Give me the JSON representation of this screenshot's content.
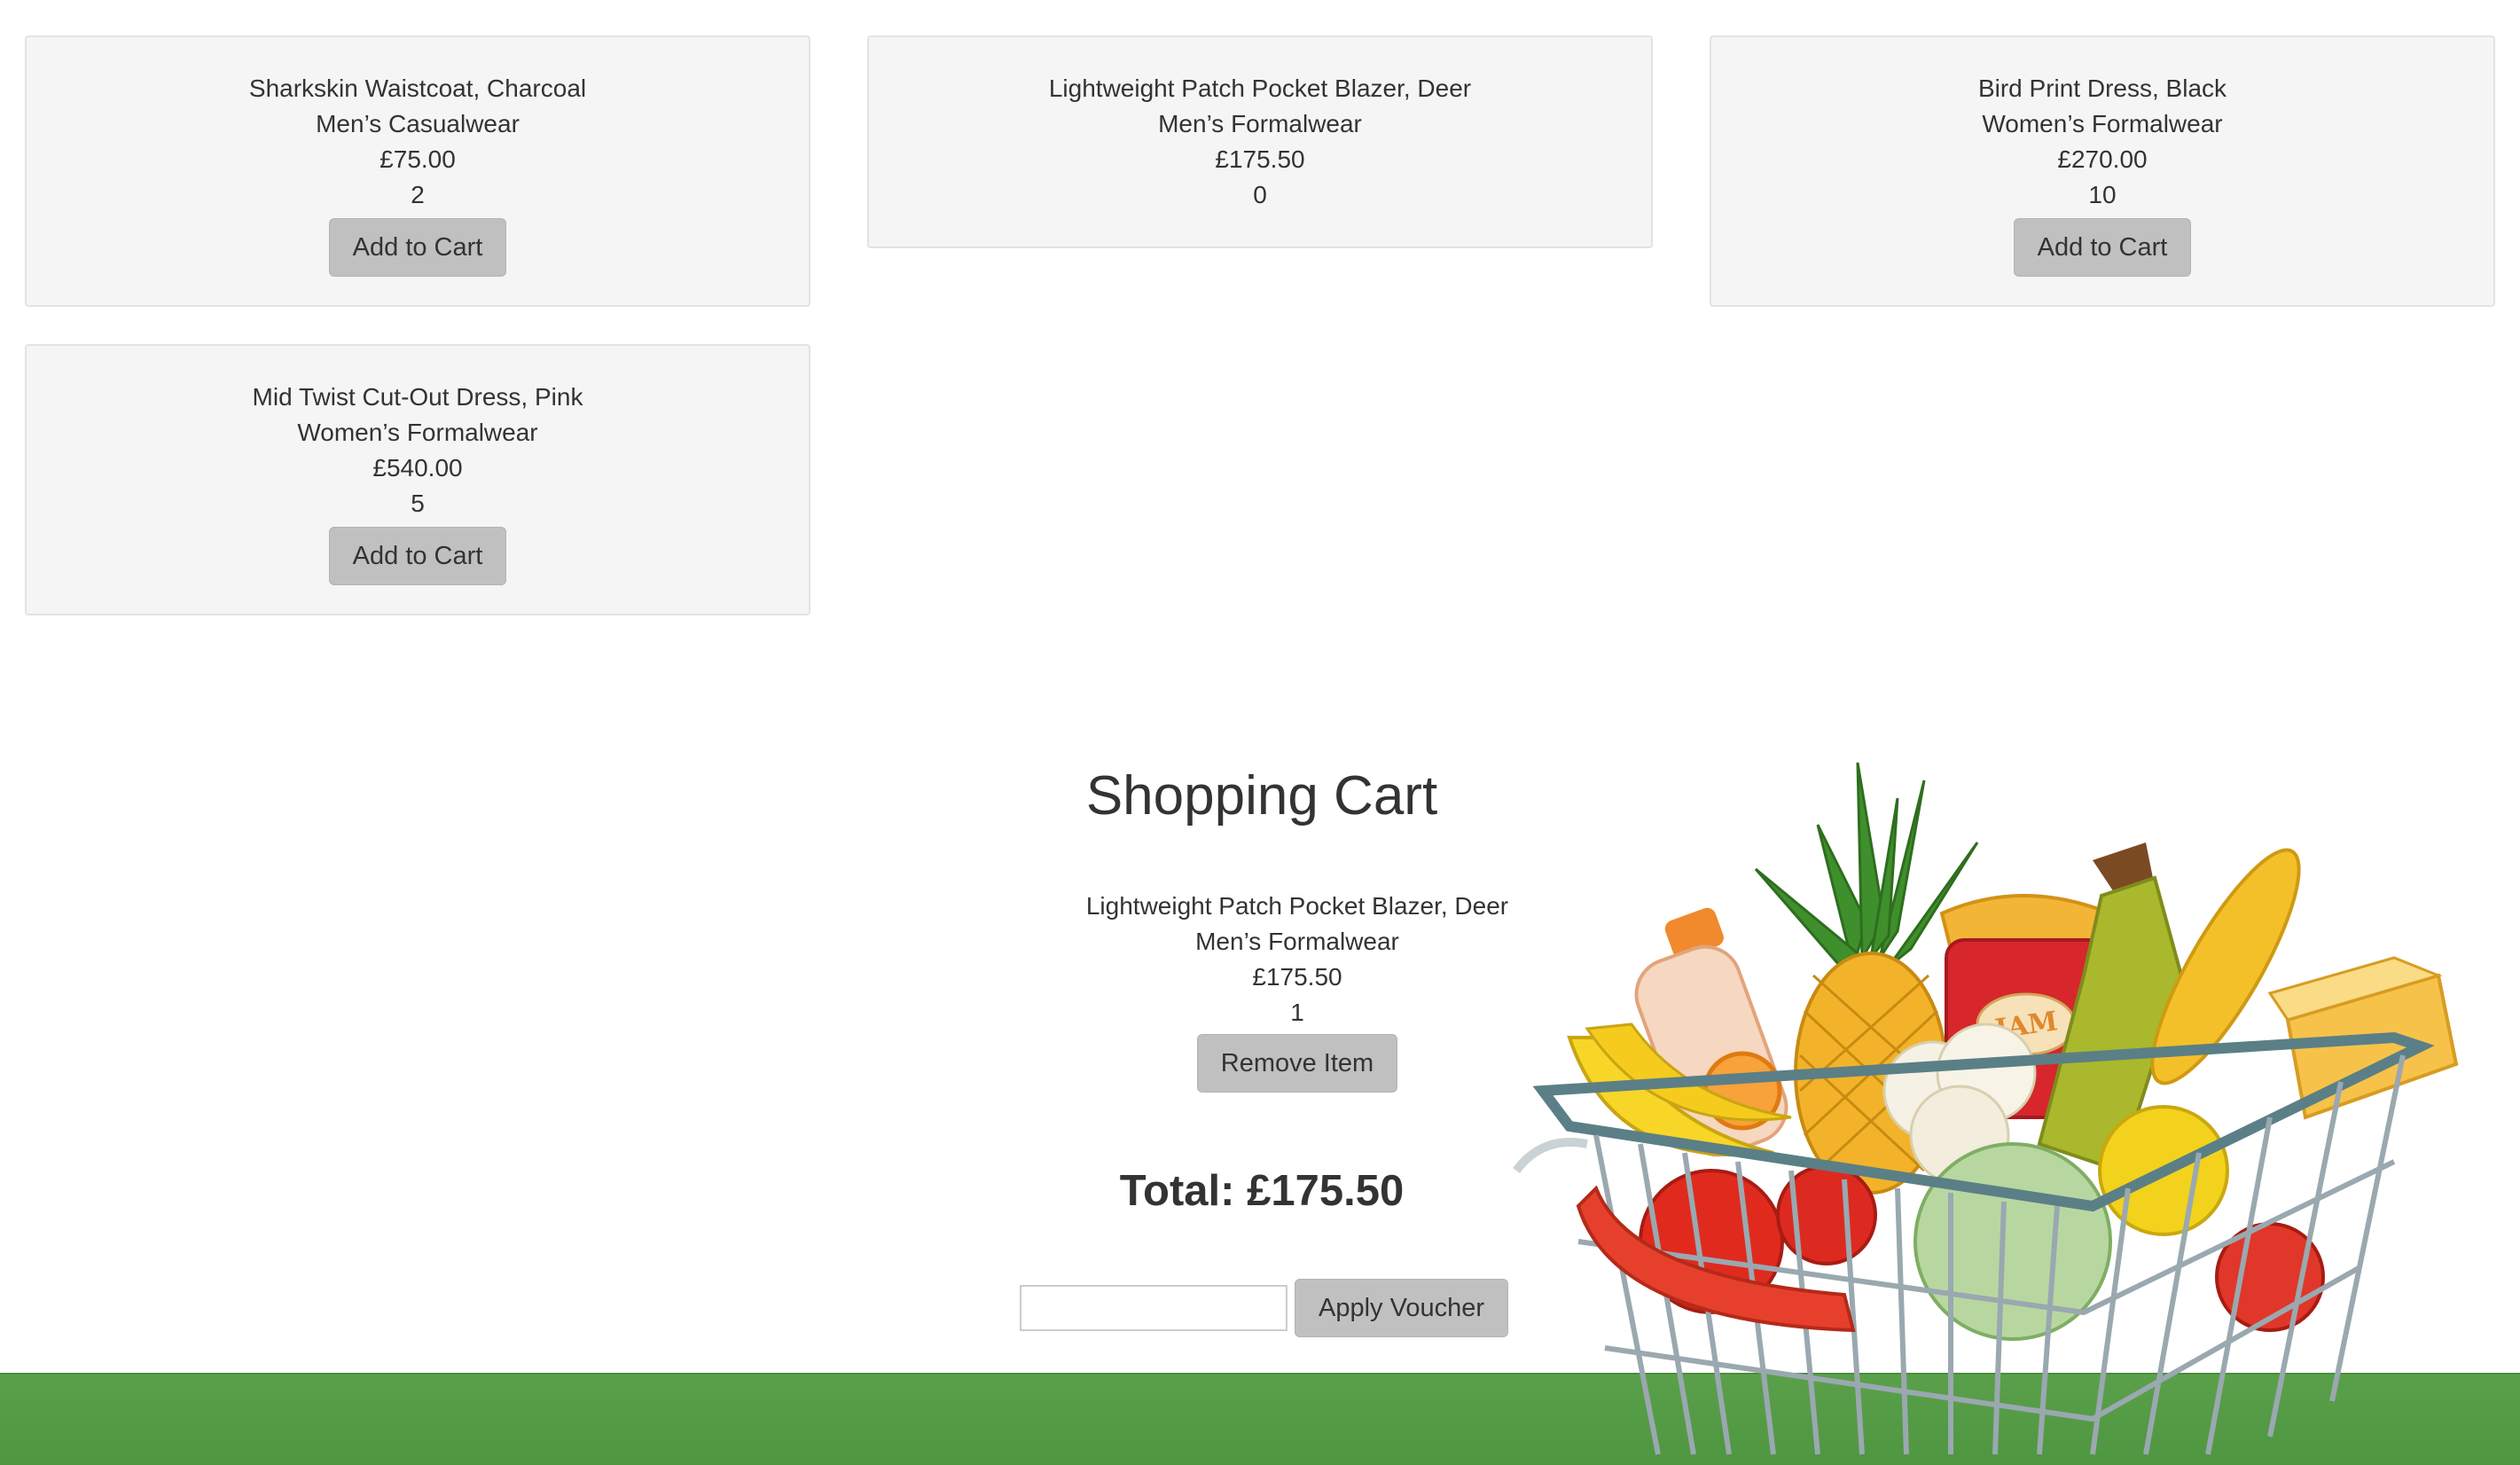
{
  "products": [
    {
      "name": "Sharkskin Waistcoat, Charcoal",
      "category": "Men’s Casualwear",
      "price": "£75.00",
      "stock": "2",
      "button": "Add to Cart"
    },
    {
      "name": "Lightweight Patch Pocket Blazer, Deer",
      "category": "Men’s Formalwear",
      "price": "£175.50",
      "stock": "0"
    },
    {
      "name": "Bird Print Dress, Black",
      "category": "Women’s Formalwear",
      "price": "£270.00",
      "stock": "10",
      "button": "Add to Cart"
    },
    {
      "name": "Mid Twist Cut-Out Dress, Pink",
      "category": "Women’s Formalwear",
      "price": "£540.00",
      "stock": "5",
      "button": "Add to Cart"
    }
  ],
  "cart": {
    "title": "Shopping Cart",
    "items": [
      {
        "name": "Lightweight Patch Pocket Blazer, Deer",
        "category": "Men’s Formalwear",
        "price": "£175.50",
        "quantity": "1",
        "button": "Remove Item"
      }
    ],
    "total": "Total: £175.50",
    "voucher": {
      "value": "",
      "placeholder": "",
      "button": "Apply Voucher"
    }
  },
  "colors": {
    "card_bg": "#f5f5f5",
    "button_bg": "#c0c0c0",
    "footer_green": "#569d46",
    "text": "#333333"
  },
  "illustration": {
    "icon": "grocery-basket-icon",
    "label": "JAM"
  }
}
